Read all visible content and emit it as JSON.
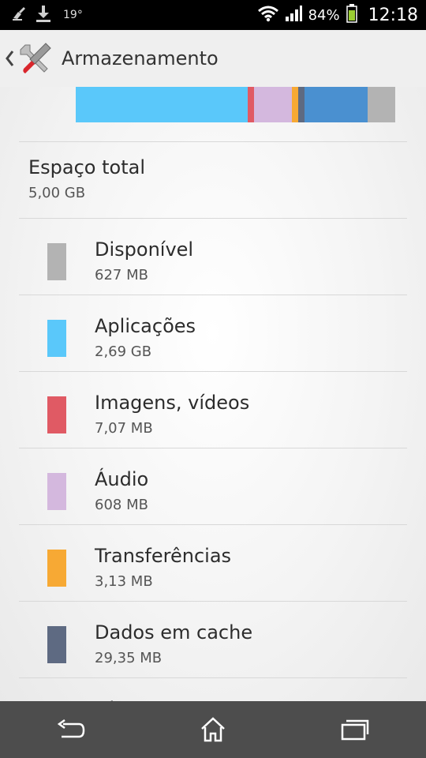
{
  "status_bar": {
    "temperature": "19°",
    "battery_percent": "84%",
    "time": "12:18",
    "icons": [
      "cleaner-icon",
      "download-icon",
      "wifi-icon",
      "signal-icon",
      "battery-icon"
    ]
  },
  "action_bar": {
    "title": "Armazenamento",
    "back_icon": "chevron-left-icon",
    "app_icon": "tools-icon"
  },
  "usage_bar": {
    "segments": [
      {
        "name": "Aplicações",
        "color": "#5ac8fa",
        "fraction": 0.538
      },
      {
        "name": "Imagens, vídeos",
        "color": "#e05a64",
        "fraction": 0.02
      },
      {
        "name": "Áudio",
        "color": "#d4b8de",
        "fraction": 0.119
      },
      {
        "name": "Transferências",
        "color": "#f7a934",
        "fraction": 0.02
      },
      {
        "name": "Dados em cache",
        "color": "#5e6a82",
        "fraction": 0.02
      },
      {
        "name": "Diversos",
        "color": "#4a90d0",
        "fraction": 0.196
      },
      {
        "name": "Disponível",
        "color": "#b3b3b3",
        "fraction": 0.087
      }
    ]
  },
  "total": {
    "label": "Espaço total",
    "value": "5,00 GB"
  },
  "categories": [
    {
      "name": "Disponível",
      "size": "627 MB",
      "color": "#b3b3b3"
    },
    {
      "name": "Aplicações",
      "size": "2,69 GB",
      "color": "#5ac8fa"
    },
    {
      "name": "Imagens, vídeos",
      "size": "7,07 MB",
      "color": "#e05a64"
    },
    {
      "name": "Áudio",
      "size": "608 MB",
      "color": "#d4b8de"
    },
    {
      "name": "Transferências",
      "size": "3,13 MB",
      "color": "#f7a934"
    },
    {
      "name": "Dados em cache",
      "size": "29,35 MB",
      "color": "#5e6a82"
    },
    {
      "name": "Di",
      "size": "",
      "color": "#4a90d0"
    }
  ],
  "nav_bar": {
    "buttons": [
      "back-icon",
      "home-icon",
      "recents-icon"
    ]
  }
}
